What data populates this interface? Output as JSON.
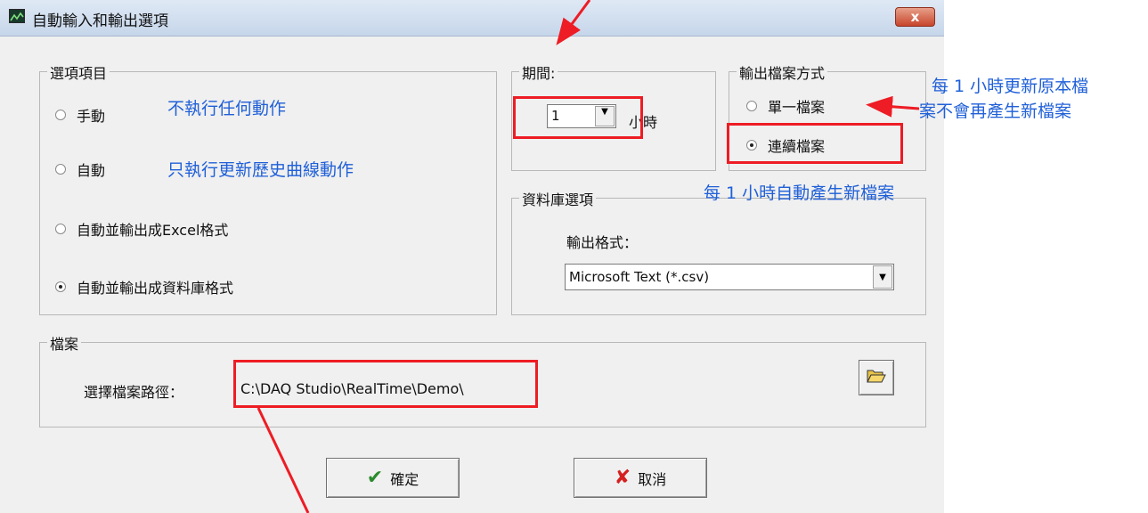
{
  "window": {
    "title": "自動輸入和輸出選項",
    "close_label": "x"
  },
  "options_group": {
    "label": "選項項目",
    "items": [
      {
        "label": "手動",
        "checked": false
      },
      {
        "label": "自動",
        "checked": false
      },
      {
        "label": "自動並輸出成Excel格式",
        "checked": false
      },
      {
        "label": "自動並輸出成資料庫格式",
        "checked": true
      }
    ]
  },
  "period_group": {
    "label": "期間:",
    "value": "1",
    "unit": "小時"
  },
  "output_mode_group": {
    "label": "輸出檔案方式",
    "items": [
      {
        "label": "單一檔案",
        "checked": false
      },
      {
        "label": "連續檔案",
        "checked": true
      }
    ]
  },
  "database_group": {
    "label": "資料庫選項",
    "format_label": "輸出格式：",
    "format_value": "Microsoft Text (*.csv)"
  },
  "file_group": {
    "label": "檔案",
    "path_label": "選擇檔案路徑：",
    "path_value": "C:\\DAQ Studio\\RealTime\\Demo\\"
  },
  "buttons": {
    "ok_label": "確定",
    "cancel_label": "取消"
  },
  "annotations": {
    "manual_note": "不執行任何動作",
    "auto_note": "只執行更新歷史曲線動作",
    "single_file_note_line1": "每 1 小時更新原本檔",
    "single_file_note_line2": "案不會再產生新檔案",
    "continuous_note": "每 1 小時自動產生新檔案",
    "note_color": "#2060d8",
    "highlight_color": "#ee1c24"
  },
  "icons": {
    "app": "chart-icon",
    "ok": "checkmark-icon",
    "cancel": "x-icon",
    "folder": "folder-open-icon",
    "dropdown": "chevron-down-icon"
  }
}
